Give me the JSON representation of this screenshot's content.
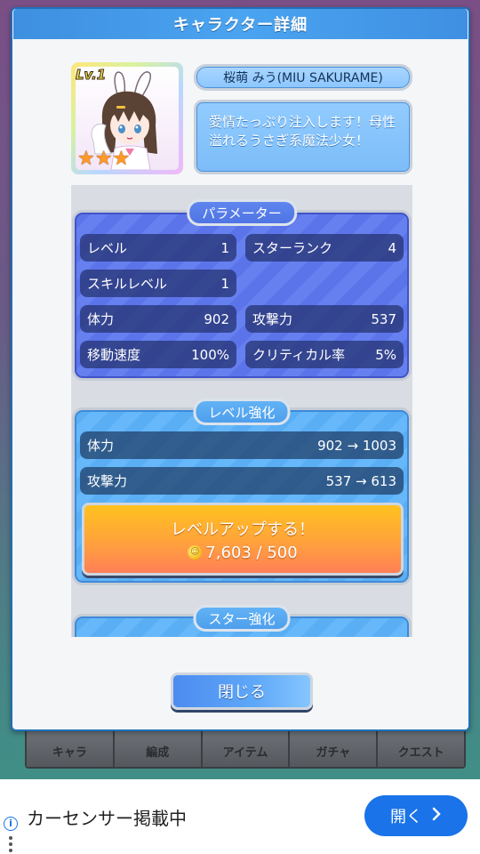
{
  "dialog": {
    "title": "キャラクター詳細",
    "level_badge": "Lv.1",
    "stars": [
      "★",
      "★",
      "★"
    ],
    "character_name": "桜萌 みう(MIU SAKURAME)",
    "description": "愛情たっぷり注入します！母性溢れるうさぎ系魔法少女！",
    "close_label": "閉じる"
  },
  "parameters": {
    "title": "パラメーター",
    "stats": [
      {
        "label": "レベル",
        "value": "1"
      },
      {
        "label": "スターランク",
        "value": "4"
      },
      {
        "label": "スキルレベル",
        "value": "1"
      },
      {
        "label": "体力",
        "value": "902"
      },
      {
        "label": "攻撃力",
        "value": "537"
      },
      {
        "label": "移動速度",
        "value": "100%"
      },
      {
        "label": "クリティカル率",
        "value": "5%"
      }
    ]
  },
  "level_up": {
    "title": "レベル強化",
    "rows": [
      {
        "label": "体力",
        "value": "902 → 1003"
      },
      {
        "label": "攻撃力",
        "value": "537 → 613"
      }
    ],
    "button_label": "レベルアップする！",
    "cost": "7,603 / 500"
  },
  "star_up": {
    "title": "スター強化"
  },
  "bottom_nav": {
    "items": [
      "キャラ",
      "編成",
      "アイテム",
      "ガチャ",
      "クエスト"
    ]
  },
  "ad": {
    "text": "カーセンサー掲載中",
    "button_label": "開く",
    "button_icon": "chevron-right-icon"
  },
  "colors": {
    "header": "#4aa4f0",
    "param_panel": "#5c74ea",
    "level_panel": "#5aaef4",
    "levelup_button": "#ffa53a",
    "ad_button": "#1a73e8"
  }
}
